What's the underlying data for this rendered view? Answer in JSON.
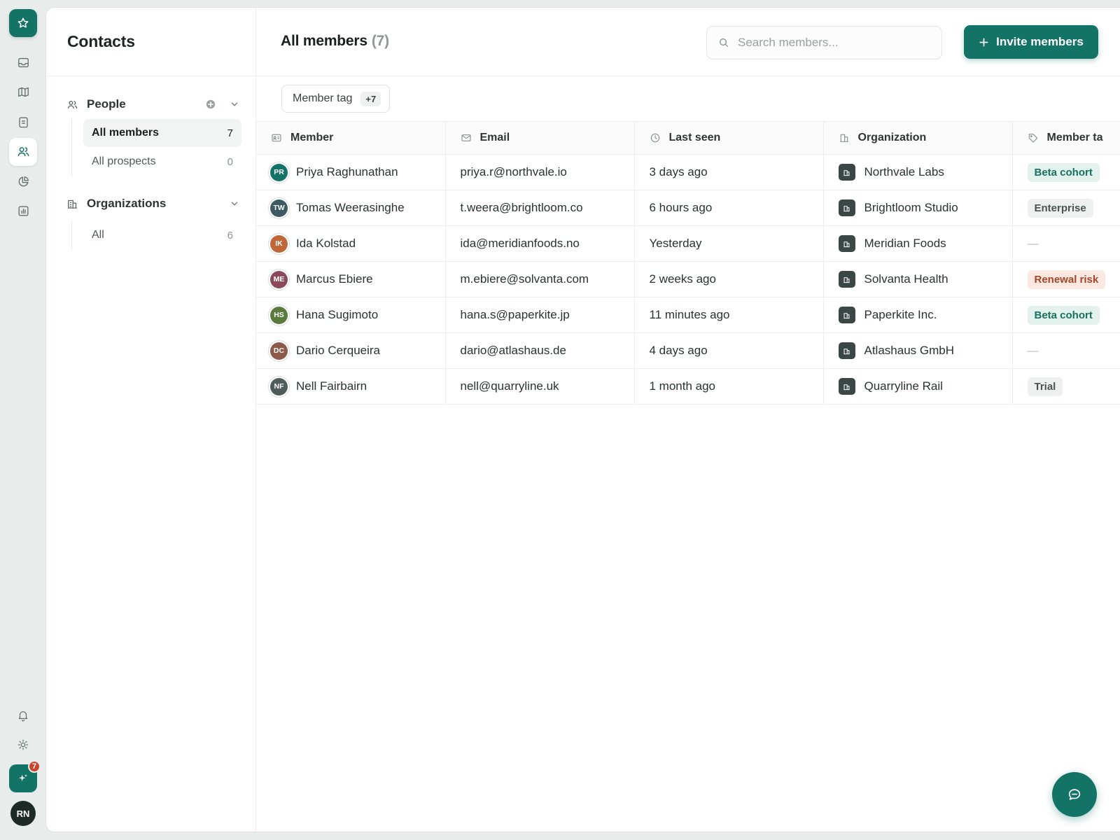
{
  "rail": {
    "logo_icon": "star-icon",
    "nav": [
      {
        "icon": "inbox-icon",
        "active": false
      },
      {
        "icon": "map-icon",
        "active": false
      },
      {
        "icon": "clipboard-icon",
        "active": false
      },
      {
        "icon": "users-icon",
        "active": true
      },
      {
        "icon": "pie-chart-icon",
        "active": false
      },
      {
        "icon": "bar-chart-icon",
        "active": false
      }
    ],
    "bottom": {
      "bell_icon": "bell-icon",
      "settings_icon": "sun-icon",
      "spark_icon": "sparkle-icon",
      "spark_badge": "7",
      "avatar_initials": "RN"
    }
  },
  "sidebar": {
    "title": "Contacts",
    "people": {
      "label": "People",
      "items": [
        {
          "label": "All members",
          "count": "7",
          "active": true
        },
        {
          "label": "All prospects",
          "count": "0",
          "active": false
        }
      ]
    },
    "organizations": {
      "label": "Organizations",
      "items": [
        {
          "label": "All",
          "count": "6",
          "active": false
        }
      ]
    }
  },
  "header": {
    "title": "All members",
    "count": "(7)",
    "search_placeholder": "Search members...",
    "invite_label": "Invite members"
  },
  "filters": {
    "chip_label": "Member tag",
    "chip_more": "+7"
  },
  "table": {
    "columns": [
      {
        "label": "Member",
        "icon": "id-card-icon"
      },
      {
        "label": "Email",
        "icon": "mail-icon"
      },
      {
        "label": "Last seen",
        "icon": "clock-icon"
      },
      {
        "label": "Organization",
        "icon": "building-icon"
      },
      {
        "label": "Member ta",
        "icon": "tag-icon"
      }
    ],
    "rows": [
      {
        "initials": "PR",
        "avatar_color": "#137366",
        "name": "Priya Raghunathan",
        "email": "priya.r@northvale.io",
        "last_seen": "3 days ago",
        "org": "Northvale Labs",
        "tag": "Beta cohort",
        "tag_style": "green"
      },
      {
        "initials": "TW",
        "avatar_color": "#3d5a63",
        "name": "Tomas Weerasinghe",
        "email": "t.weera@brightloom.co",
        "last_seen": "6 hours ago",
        "org": "Brightloom Studio",
        "tag": "Enterprise",
        "tag_style": "gray"
      },
      {
        "initials": "IK",
        "avatar_color": "#c0673a",
        "name": "Ida Kolstad",
        "email": "ida@meridianfoods.no",
        "last_seen": "Yesterday",
        "org": "Meridian Foods",
        "tag": "—",
        "tag_style": "none"
      },
      {
        "initials": "ME",
        "avatar_color": "#8a4a5c",
        "name": "Marcus Ebiere",
        "email": "m.ebiere@solvanta.com",
        "last_seen": "2 weeks ago",
        "org": "Solvanta Health",
        "tag": "Renewal risk",
        "tag_style": "red"
      },
      {
        "initials": "HS",
        "avatar_color": "#5a7a3e",
        "name": "Hana Sugimoto",
        "email": "hana.s@paperkite.jp",
        "last_seen": "11 minutes ago",
        "org": "Paperkite Inc.",
        "tag": "Beta cohort",
        "tag_style": "green"
      },
      {
        "initials": "DC",
        "avatar_color": "#8b5a49",
        "name": "Dario Cerqueira",
        "email": "dario@atlashaus.de",
        "last_seen": "4 days ago",
        "org": "Atlashaus GmbH",
        "tag": "—",
        "tag_style": "none"
      },
      {
        "initials": "NF",
        "avatar_color": "#4f5c5a",
        "name": "Nell Fairbairn",
        "email": "nell@quarryline.uk",
        "last_seen": "1 month ago",
        "org": "Quarryline Rail",
        "tag": "Trial",
        "tag_style": "gray"
      }
    ]
  },
  "chat_fab_icon": "chat-icon",
  "colors": {
    "accent": "#137366",
    "tag_green_bg": "#e4f2ee",
    "tag_green_fg": "#16715f",
    "tag_gray_bg": "#eef0ef",
    "tag_gray_fg": "#4b5351",
    "tag_red_bg": "#fbe8e1",
    "tag_red_fg": "#a4462b"
  }
}
